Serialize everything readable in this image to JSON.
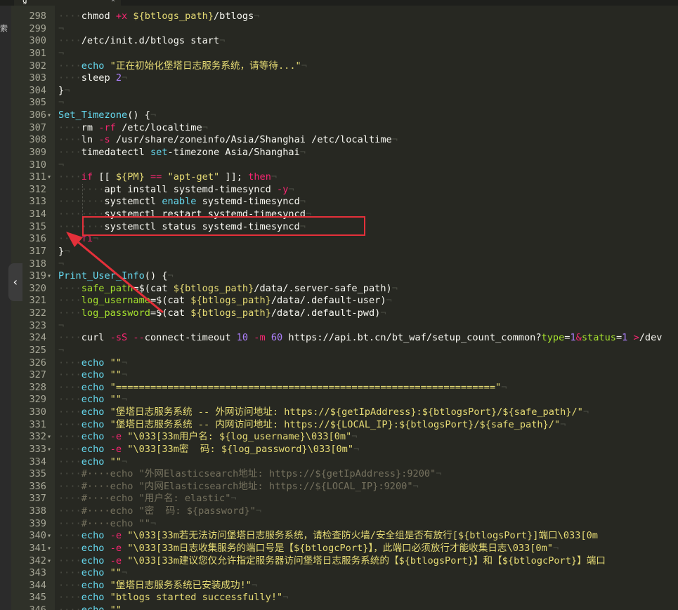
{
  "tab": {
    "title": "g",
    "close": "×"
  },
  "side": {
    "label": "索"
  },
  "collapse": {
    "glyph": "‹"
  },
  "colors": {
    "annotation": "#e4303a",
    "background": "#272822"
  },
  "lines": [
    {
      "n": "298",
      "fold": "",
      "t": [
        [
          "ws",
          "····"
        ],
        [
          "",
          "chmod "
        ],
        [
          "kw",
          "+x "
        ],
        [
          "st",
          "${btlogs_path}"
        ],
        [
          "",
          "/btlogs"
        ],
        [
          "ws",
          "¬"
        ]
      ]
    },
    {
      "n": "299",
      "fold": "",
      "t": [
        [
          "ws",
          "¬"
        ]
      ]
    },
    {
      "n": "300",
      "fold": "",
      "t": [
        [
          "ws",
          "····"
        ],
        [
          "",
          "/etc/init.d/btlogs start"
        ],
        [
          "ws",
          "¬"
        ]
      ]
    },
    {
      "n": "301",
      "fold": "",
      "t": [
        [
          "ws",
          "¬"
        ]
      ]
    },
    {
      "n": "302",
      "fold": "",
      "t": [
        [
          "ws",
          "····"
        ],
        [
          "fn",
          "echo "
        ],
        [
          "st",
          "\"正在初始化堡塔日志服务系统，请等待...\""
        ],
        [
          "ws",
          "¬"
        ]
      ]
    },
    {
      "n": "303",
      "fold": "",
      "t": [
        [
          "ws",
          "····"
        ],
        [
          "",
          "sleep "
        ],
        [
          "nm",
          "2"
        ],
        [
          "ws",
          "¬"
        ]
      ]
    },
    {
      "n": "304",
      "fold": "",
      "t": [
        [
          "",
          "}"
        ],
        [
          "ws",
          "¬"
        ]
      ]
    },
    {
      "n": "305",
      "fold": "",
      "t": [
        [
          "ws",
          "¬"
        ]
      ]
    },
    {
      "n": "306",
      "fold": "▾",
      "t": [
        [
          "fn",
          "Set_Timezone"
        ],
        [
          "",
          "() {"
        ],
        [
          "ws",
          "¬"
        ]
      ]
    },
    {
      "n": "307",
      "fold": "",
      "t": [
        [
          "ws",
          "····"
        ],
        [
          "",
          "rm "
        ],
        [
          "kw",
          "-rf "
        ],
        [
          "",
          "/etc/localtime"
        ],
        [
          "ws",
          "¬"
        ]
      ]
    },
    {
      "n": "308",
      "fold": "",
      "t": [
        [
          "ws",
          "····"
        ],
        [
          "",
          "ln "
        ],
        [
          "kw",
          "-s "
        ],
        [
          "",
          "/usr/share/zoneinfo/Asia/Shanghai /etc/localtime"
        ],
        [
          "ws",
          "¬"
        ]
      ]
    },
    {
      "n": "309",
      "fold": "",
      "t": [
        [
          "ws",
          "····"
        ],
        [
          "",
          "timedatectl "
        ],
        [
          "fn",
          "set"
        ],
        [
          "",
          "-timezone Asia/Shanghai"
        ],
        [
          "ws",
          "¬"
        ]
      ]
    },
    {
      "n": "310",
      "fold": "",
      "t": [
        [
          "ws",
          "¬"
        ]
      ]
    },
    {
      "n": "311",
      "fold": "▾",
      "t": [
        [
          "ws",
          "····"
        ],
        [
          "kw",
          "if "
        ],
        [
          "",
          "[[ "
        ],
        [
          "st",
          "${PM}"
        ],
        [
          "kw",
          " == "
        ],
        [
          "st",
          "\"apt-get\""
        ],
        [
          "",
          ""
        ],
        [
          "",
          " ]]; "
        ],
        [
          "kw",
          "then"
        ],
        [
          "ws",
          "¬"
        ]
      ]
    },
    {
      "n": "312",
      "fold": "",
      "t": [
        [
          "ws",
          "········"
        ],
        [
          "",
          "apt install systemd-timesyncd "
        ],
        [
          "kw",
          "-y"
        ],
        [
          "ws",
          "¬"
        ]
      ]
    },
    {
      "n": "313",
      "fold": "",
      "t": [
        [
          "ws",
          "········"
        ],
        [
          "",
          "systemctl "
        ],
        [
          "fn",
          "enable "
        ],
        [
          "",
          "systemd-timesyncd"
        ],
        [
          "ws",
          "¬"
        ]
      ]
    },
    {
      "n": "314",
      "fold": "",
      "t": [
        [
          "ws",
          "········"
        ],
        [
          "",
          "systemctl restart systemd-timesyncd"
        ],
        [
          "ws",
          "¬"
        ]
      ]
    },
    {
      "n": "315",
      "fold": "",
      "t": [
        [
          "ws",
          "········"
        ],
        [
          "",
          "systemctl status systemd-timesyncd"
        ],
        [
          "ws",
          "¬"
        ]
      ]
    },
    {
      "n": "316",
      "fold": "",
      "t": [
        [
          "ws",
          "····"
        ],
        [
          "kw",
          "fi"
        ],
        [
          "ws",
          "¬"
        ]
      ]
    },
    {
      "n": "317",
      "fold": "",
      "t": [
        [
          "",
          "}"
        ],
        [
          "ws",
          "¬"
        ]
      ]
    },
    {
      "n": "318",
      "fold": "",
      "t": [
        [
          "ws",
          "¬"
        ]
      ]
    },
    {
      "n": "319",
      "fold": "▾",
      "t": [
        [
          "fn",
          "Print_User_Info"
        ],
        [
          "",
          "() {"
        ],
        [
          "ws",
          "¬"
        ]
      ]
    },
    {
      "n": "320",
      "fold": "",
      "t": [
        [
          "ws",
          "····"
        ],
        [
          "vr",
          "safe_path"
        ],
        [
          "",
          "=$(cat "
        ],
        [
          "st",
          "${btlogs_path}"
        ],
        [
          "",
          "/data/.server-safe_path)"
        ],
        [
          "ws",
          "¬"
        ]
      ]
    },
    {
      "n": "321",
      "fold": "",
      "t": [
        [
          "ws",
          "····"
        ],
        [
          "vr",
          "log_username"
        ],
        [
          "",
          "=$(cat "
        ],
        [
          "st",
          "${btlogs_path}"
        ],
        [
          "",
          "/data/.default-user)"
        ],
        [
          "ws",
          "¬"
        ]
      ]
    },
    {
      "n": "322",
      "fold": "",
      "t": [
        [
          "ws",
          "····"
        ],
        [
          "vr",
          "log_password"
        ],
        [
          "",
          "=$(cat "
        ],
        [
          "st",
          "${btlogs_path}"
        ],
        [
          "",
          "/data/.default-pwd)"
        ],
        [
          "ws",
          "¬"
        ]
      ]
    },
    {
      "n": "323",
      "fold": "",
      "t": [
        [
          "ws",
          "¬"
        ]
      ]
    },
    {
      "n": "324",
      "fold": "",
      "t": [
        [
          "ws",
          "····"
        ],
        [
          "",
          "curl "
        ],
        [
          "kw",
          "-sS --"
        ],
        [
          "",
          "connect-timeout "
        ],
        [
          "nm",
          "10 "
        ],
        [
          "kw",
          "-m "
        ],
        [
          "nm",
          "60 "
        ],
        [
          "",
          "https://api.bt.cn/bt_waf/setup_count_common?"
        ],
        [
          "vr",
          "type"
        ],
        [
          "",
          "="
        ],
        [
          "nm",
          "1"
        ],
        [
          "kw",
          "&"
        ],
        [
          "vr",
          "status"
        ],
        [
          "",
          "="
        ],
        [
          "nm",
          "1 "
        ],
        [
          "kw",
          ">"
        ],
        [
          "",
          "/dev"
        ]
      ]
    },
    {
      "n": "325",
      "fold": "",
      "t": [
        [
          "ws",
          "¬"
        ]
      ]
    },
    {
      "n": "326",
      "fold": "",
      "t": [
        [
          "ws",
          "····"
        ],
        [
          "fn",
          "echo "
        ],
        [
          "st",
          "\"\""
        ],
        [
          "ws",
          "¬"
        ]
      ]
    },
    {
      "n": "327",
      "fold": "",
      "t": [
        [
          "ws",
          "····"
        ],
        [
          "fn",
          "echo "
        ],
        [
          "st",
          "\"\""
        ],
        [
          "ws",
          "¬"
        ]
      ]
    },
    {
      "n": "328",
      "fold": "",
      "t": [
        [
          "ws",
          "····"
        ],
        [
          "fn",
          "echo "
        ],
        [
          "st",
          "\"==================================================================\""
        ],
        [
          "ws",
          "¬"
        ]
      ]
    },
    {
      "n": "329",
      "fold": "",
      "t": [
        [
          "ws",
          "····"
        ],
        [
          "fn",
          "echo "
        ],
        [
          "st",
          "\"\""
        ],
        [
          "ws",
          "¬"
        ]
      ]
    },
    {
      "n": "330",
      "fold": "",
      "t": [
        [
          "ws",
          "····"
        ],
        [
          "fn",
          "echo "
        ],
        [
          "st",
          "\"堡塔日志服务系统 -- 外网访问地址: https://${getIpAddress}:${btlogsPort}/${safe_path}/\""
        ],
        [
          "ws",
          "¬"
        ]
      ]
    },
    {
      "n": "331",
      "fold": "",
      "t": [
        [
          "ws",
          "····"
        ],
        [
          "fn",
          "echo "
        ],
        [
          "st",
          "\"堡塔日志服务系统 -- 内网访问地址: https://${LOCAL_IP}:${btlogsPort}/${safe_path}/\""
        ],
        [
          "ws",
          "¬"
        ]
      ]
    },
    {
      "n": "332",
      "fold": "▾",
      "t": [
        [
          "ws",
          "····"
        ],
        [
          "fn",
          "echo "
        ],
        [
          "kw",
          "-e "
        ],
        [
          "st",
          "\"\\033[33m用户名: ${log_username}\\033[0m\""
        ],
        [
          "ws",
          "¬"
        ]
      ]
    },
    {
      "n": "333",
      "fold": "▾",
      "t": [
        [
          "ws",
          "····"
        ],
        [
          "fn",
          "echo "
        ],
        [
          "kw",
          "-e "
        ],
        [
          "st",
          "\"\\033[33m密  码: ${log_password}\\033[0m\""
        ],
        [
          "ws",
          "¬"
        ]
      ]
    },
    {
      "n": "334",
      "fold": "",
      "t": [
        [
          "ws",
          "····"
        ],
        [
          "fn",
          "echo "
        ],
        [
          "st",
          "\"\""
        ],
        [
          "ws",
          "¬"
        ]
      ]
    },
    {
      "n": "335",
      "fold": "",
      "t": [
        [
          "ws",
          "····"
        ],
        [
          "cm",
          "#····echo \"外网Elasticsearch地址: https://${getIpAddress}:9200\""
        ],
        [
          "ws",
          "¬"
        ]
      ]
    },
    {
      "n": "336",
      "fold": "",
      "t": [
        [
          "ws",
          "····"
        ],
        [
          "cm",
          "#····echo \"内网Elasticsearch地址: https://${LOCAL_IP}:9200\""
        ],
        [
          "ws",
          "¬"
        ]
      ]
    },
    {
      "n": "337",
      "fold": "",
      "t": [
        [
          "ws",
          "····"
        ],
        [
          "cm",
          "#····echo \"用户名: elastic\""
        ],
        [
          "ws",
          "¬"
        ]
      ]
    },
    {
      "n": "338",
      "fold": "",
      "t": [
        [
          "ws",
          "····"
        ],
        [
          "cm",
          "#····echo \"密  码: ${password}\""
        ],
        [
          "ws",
          "¬"
        ]
      ]
    },
    {
      "n": "339",
      "fold": "",
      "t": [
        [
          "ws",
          "····"
        ],
        [
          "cm",
          "#····echo \"\""
        ],
        [
          "ws",
          "¬"
        ]
      ]
    },
    {
      "n": "340",
      "fold": "▾",
      "t": [
        [
          "ws",
          "····"
        ],
        [
          "fn",
          "echo "
        ],
        [
          "kw",
          "-e "
        ],
        [
          "st",
          "\"\\033[33m若无法访问堡塔日志服务系统，请检查防火墙/安全组是否有放行[${btlogsPort}]端口\\033[0m"
        ]
      ]
    },
    {
      "n": "341",
      "fold": "▾",
      "t": [
        [
          "ws",
          "····"
        ],
        [
          "fn",
          "echo "
        ],
        [
          "kw",
          "-e "
        ],
        [
          "st",
          "\"\\033[33m日志收集服务的端口号是【${btlogcPort}】，此端口必须放行才能收集日志\\033[0m\""
        ],
        [
          "ws",
          "¬"
        ]
      ]
    },
    {
      "n": "342",
      "fold": "▾",
      "t": [
        [
          "ws",
          "····"
        ],
        [
          "fn",
          "echo "
        ],
        [
          "kw",
          "-e "
        ],
        [
          "st",
          "\"\\033[33m建议您仅允许指定服务器访问堡塔日志服务系统的【${btlogsPort}】和【${btlogcPort}】端口"
        ]
      ]
    },
    {
      "n": "343",
      "fold": "",
      "t": [
        [
          "ws",
          "····"
        ],
        [
          "fn",
          "echo "
        ],
        [
          "st",
          "\"\""
        ],
        [
          "ws",
          "¬"
        ]
      ]
    },
    {
      "n": "344",
      "fold": "",
      "t": [
        [
          "ws",
          "····"
        ],
        [
          "fn",
          "echo "
        ],
        [
          "st",
          "\"堡塔日志服务系统已安装成功!\""
        ],
        [
          "ws",
          "¬"
        ]
      ]
    },
    {
      "n": "345",
      "fold": "",
      "t": [
        [
          "ws",
          "····"
        ],
        [
          "fn",
          "echo "
        ],
        [
          "st",
          "\"btlogs started successfully!\""
        ],
        [
          "ws",
          "¬"
        ]
      ]
    },
    {
      "n": "346",
      "fold": "",
      "t": [
        [
          "ws",
          "····"
        ],
        [
          "fn",
          "echo "
        ],
        [
          "st",
          "\"\""
        ]
      ]
    }
  ]
}
